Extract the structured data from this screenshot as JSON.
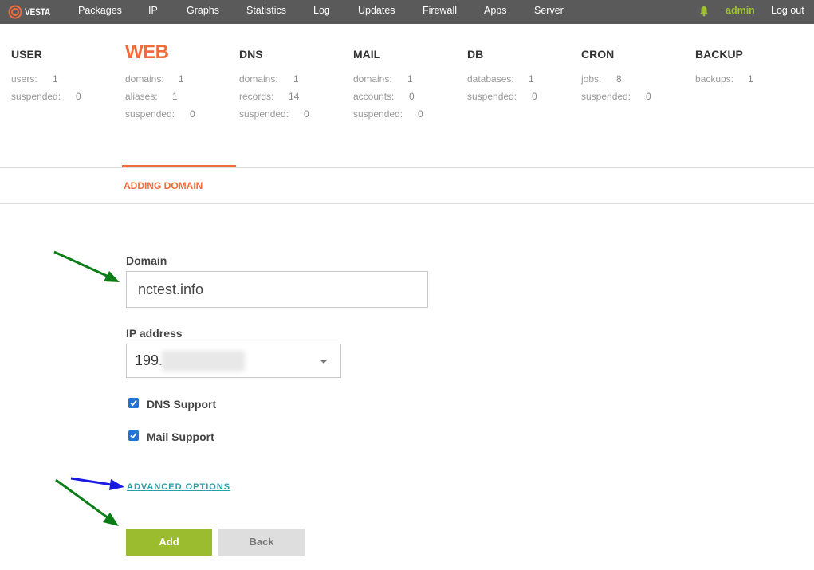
{
  "brand": {
    "logo_text": "VESTA"
  },
  "nav": {
    "items": [
      "Packages",
      "IP",
      "Graphs",
      "Statistics",
      "Log",
      "Updates",
      "Firewall",
      "Apps",
      "Server"
    ],
    "user": "admin",
    "logout": "Log out"
  },
  "stats": [
    {
      "title": "USER",
      "rows": [
        {
          "label": "users:",
          "value": "1"
        },
        {
          "label": "suspended:",
          "value": "0"
        }
      ]
    },
    {
      "title": "WEB",
      "rows": [
        {
          "label": "domains:",
          "value": "1"
        },
        {
          "label": "aliases:",
          "value": "1"
        },
        {
          "label": "suspended:",
          "value": "0"
        }
      ]
    },
    {
      "title": "DNS",
      "rows": [
        {
          "label": "domains:",
          "value": "1"
        },
        {
          "label": "records:",
          "value": "14"
        },
        {
          "label": "suspended:",
          "value": "0"
        }
      ]
    },
    {
      "title": "MAIL",
      "rows": [
        {
          "label": "domains:",
          "value": "1"
        },
        {
          "label": "accounts:",
          "value": "0"
        },
        {
          "label": "suspended:",
          "value": "0"
        }
      ]
    },
    {
      "title": "DB",
      "rows": [
        {
          "label": "databases:",
          "value": "1"
        },
        {
          "label": "suspended:",
          "value": "0"
        }
      ]
    },
    {
      "title": "CRON",
      "rows": [
        {
          "label": "jobs:",
          "value": "8"
        },
        {
          "label": "suspended:",
          "value": "0"
        }
      ]
    },
    {
      "title": "BACKUP",
      "rows": [
        {
          "label": "backups:",
          "value": "1"
        }
      ]
    }
  ],
  "section_tab": "ADDING DOMAIN",
  "form": {
    "domain_label": "Domain",
    "domain_value": "nctest.info",
    "ip_label": "IP address",
    "ip_value": "199.",
    "dns_support_label": "DNS Support",
    "mail_support_label": "Mail Support",
    "advanced_link": "ADVANCED OPTIONS",
    "add_button": "Add",
    "back_button": "Back"
  },
  "colors": {
    "accent": "#f26b3a",
    "topbar": "#5a5a5a",
    "add_green": "#9cbc2f",
    "link_teal": "#2a9fa8",
    "annotation_green": "#0a7d16",
    "annotation_blue": "#1a1ae0"
  }
}
